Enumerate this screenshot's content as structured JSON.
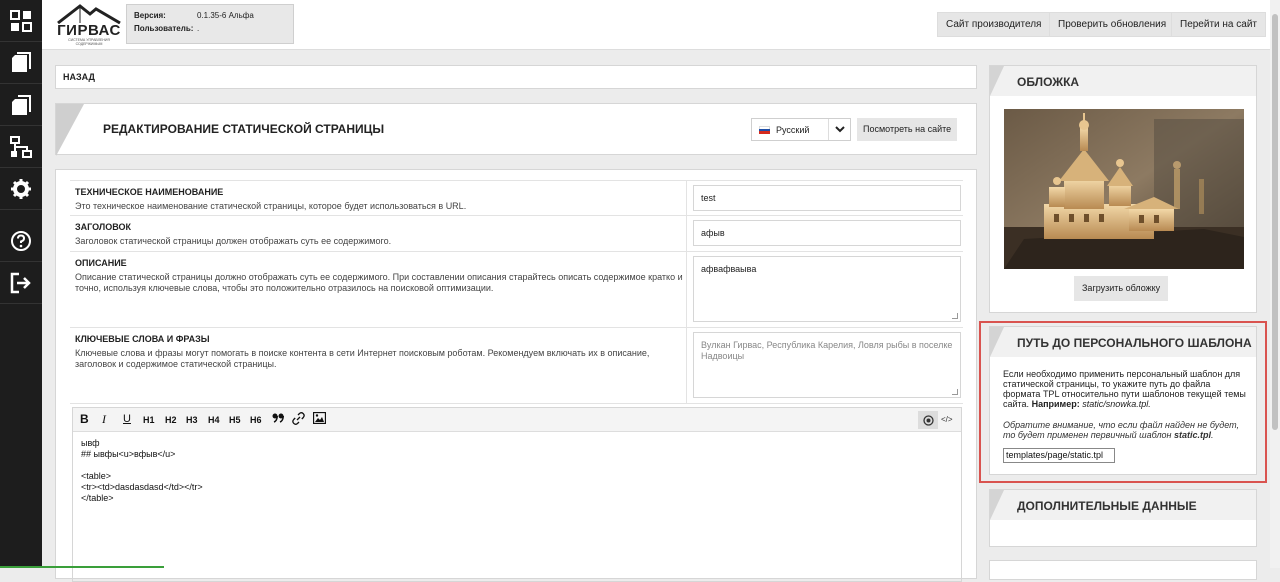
{
  "header": {
    "logo_text": "ГИРВАС",
    "logo_subtext": "СИСТЕМА УПРАВЛЕНИЯ СОДЕРЖИМЫМ",
    "version_label": "Версия:",
    "version_value": "0.1.35-6 Альфа",
    "user_label": "Пользователь:",
    "user_value": ".",
    "buttons": [
      "Сайт производителя",
      "Проверить обновления",
      "Перейти на сайт"
    ]
  },
  "sidebar": {
    "icons": [
      "dashboard-icon",
      "pages-icon",
      "copy-icon",
      "structure-icon",
      "settings-gear-icon",
      "help-icon",
      "logout-icon"
    ]
  },
  "back": {
    "label": "НАЗАД"
  },
  "page": {
    "title": "РЕДАКТИРОВАНИЕ СТАТИЧЕСКОЙ СТРАНИЦЫ",
    "language": "Русский",
    "view_on_site": "Посмотреть на сайте"
  },
  "form": {
    "fields": [
      {
        "label": "ТЕХНИЧЕСКОЕ НАИМЕНОВАНИЕ",
        "description": "Это техническое наименование статической страницы, которое будет использоваться в URL.",
        "value": "test"
      },
      {
        "label": "ЗАГОЛОВОК",
        "description": "Заголовок статической страницы должен отображать суть ее содержимого.",
        "value": "афыв"
      },
      {
        "label": "ОПИСАНИЕ",
        "description": "Описание статической страницы должно отображать суть ее содержимого. При составлении описания старайтесь описать содержимое кратко и точно, используя ключевые слова, чтобы это положительно отразилось на поисковой оптимизации.",
        "value": "афвафваыва"
      },
      {
        "label": "КЛЮЧЕВЫЕ СЛОВА И ФРАЗЫ",
        "description": "Ключевые слова и фразы могут помогать в поиске контента в сети Интернет поисковым роботам. Рекомендуем включать их в описание, заголовок и содержимое статической страницы.",
        "placeholder": "Вулкан Гирвас, Республика Карелия, Ловля рыбы в поселке Надвоицы"
      }
    ]
  },
  "editor": {
    "toolbar": [
      "B",
      "I",
      "U",
      "H1",
      "H2",
      "H3",
      "H4",
      "H5",
      "H6"
    ],
    "content": "ывф\n## ывфы<u>вфыв</u>\n\n<table>\n<tr><td>dasdasdasd</td></tr>\n</table>"
  },
  "cover": {
    "title": "ОБЛОЖКА",
    "upload_button": "Загрузить обложку"
  },
  "template": {
    "title": "ПУТЬ ДО ПЕРСОНАЛЬНОГО ШАБЛОНА",
    "description": "Если необходимо применить персональный шаблон для статической страницы, то укажите путь до файла формата TPL относительно пути шаблонов текущей темы сайта.",
    "example_label": "Например:",
    "example_value": "static/snowka.tpl.",
    "note_prefix": "Обратите внимание, что если файл найден не будет, то будет применен первичный шаблон",
    "note_file": "static.tpl",
    "input_value": "templates/page/static.tpl"
  },
  "extra": {
    "title": "ДОПОЛНИТЕЛЬНЫЕ ДАННЫЕ"
  },
  "colors": {
    "sidebar": "#1d1d1d",
    "highlight": "#d9534f",
    "progress": "#3a9f3a"
  }
}
